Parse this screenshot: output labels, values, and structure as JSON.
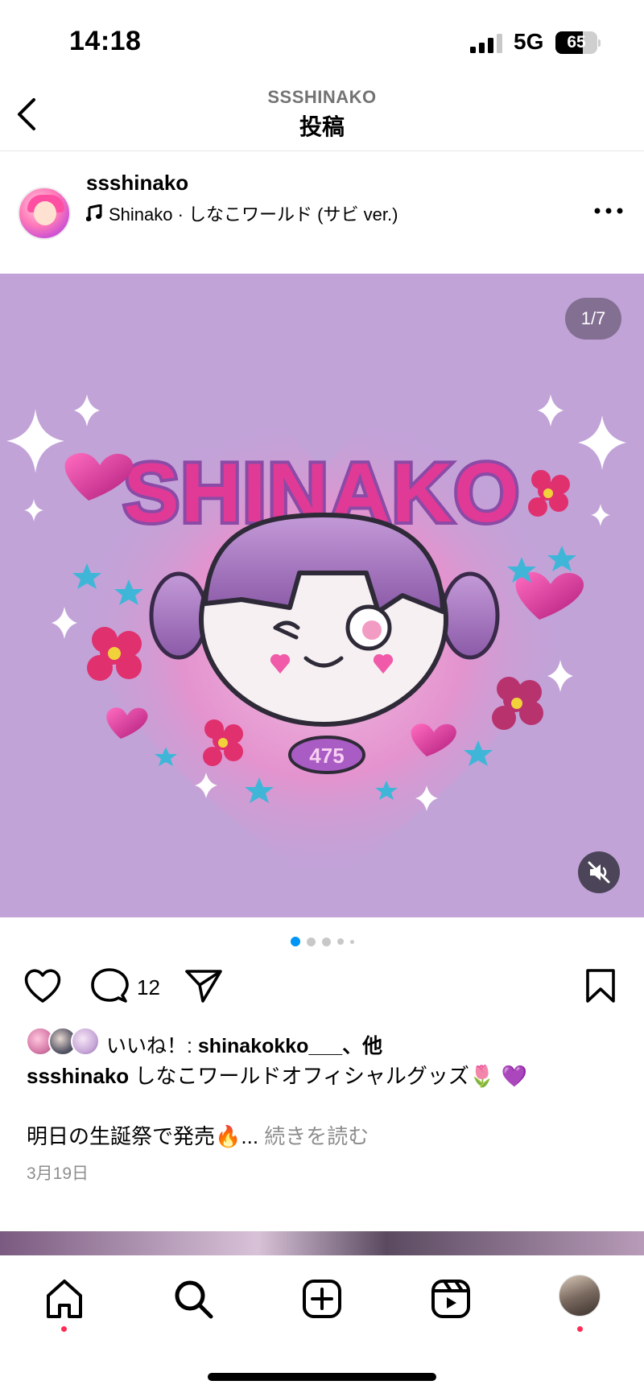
{
  "status_bar": {
    "time": "14:18",
    "network": "5G",
    "battery_level": "65",
    "battery_fraction": 0.65
  },
  "header": {
    "account": "SSSHINAKO",
    "title": "投稿"
  },
  "post": {
    "username": "ssshinako",
    "music": "Shinako · しなこワールド (サビ ver.)",
    "image_counter": "1/7",
    "logo_text": "SHINAKO",
    "badge_text": "475",
    "carousel_total": 5,
    "carousel_active": 0,
    "comment_count": "12",
    "likes_prefix": "いいね！: ",
    "likes_user": "shinakokko___",
    "likes_suffix": "、他",
    "caption_user": "ssshinako",
    "caption_text": " しなこワールドオフィシャルグッズ🌷 💜",
    "caption_line2": "明日の生誕祭で発売🔥...",
    "read_more": " 続きを読む",
    "date": "3月19日"
  },
  "colors": {
    "accent_blue": "#0095f6",
    "notification_red": "#ff2d55",
    "image_bg": "#c1a3d8",
    "logo_pink": "#e03a96",
    "logo_purple": "#8a4aa6"
  },
  "icons": {
    "back": "chevron-left-icon",
    "more": "more-horizontal-icon",
    "music": "music-note-icon",
    "like": "heart-icon",
    "comment": "comment-icon",
    "share": "paper-plane-icon",
    "save": "bookmark-icon",
    "mute": "speaker-muted-icon",
    "home": "home-icon",
    "search": "search-icon",
    "create": "plus-square-icon",
    "reels": "reels-icon",
    "profile": "profile-avatar"
  }
}
